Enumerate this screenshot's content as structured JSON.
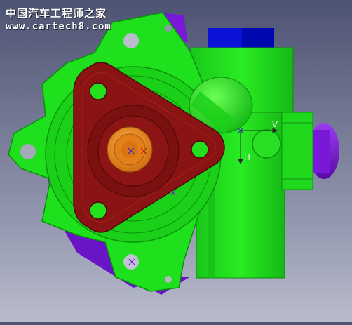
{
  "watermark": {
    "title": "中国汽车工程师之家",
    "url": "www.cartech8.com"
  },
  "axis": {
    "v_label": "V",
    "h_label": "H"
  },
  "colors": {
    "background_top": "#4d5372",
    "background_bottom": "#b9bccb",
    "housing": "#1fe01c",
    "flange": "#7a1010",
    "hub": "#e88a1f",
    "purple_parts": "#7a18d8",
    "blue_block": "#0a12d8"
  }
}
